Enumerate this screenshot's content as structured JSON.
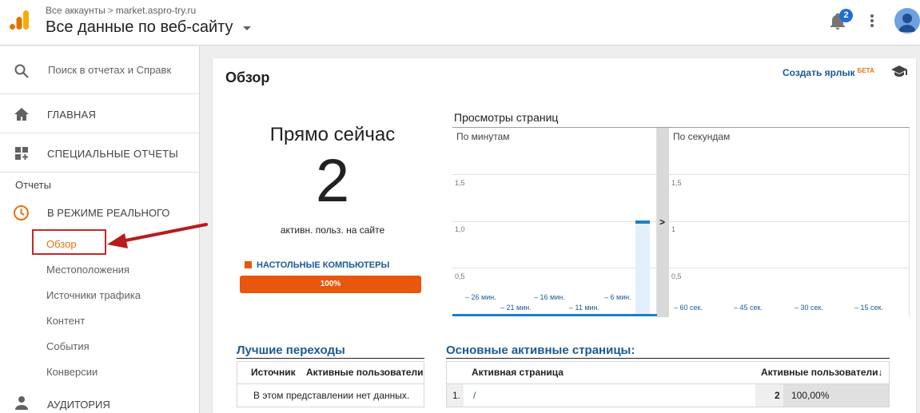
{
  "header": {
    "breadcrumb_root": "Все аккаунты",
    "breadcrumb_sep": ">",
    "breadcrumb_site": "market.aspro-try.ru",
    "view_title": "Все данные по веб-сайту",
    "notification_count": "2",
    "icons": [
      "analytics-logo-icon",
      "bell-icon",
      "more-vert-icon",
      "avatar-icon"
    ]
  },
  "sidebar": {
    "search_placeholder": "Поиск в отчетах и Справк",
    "home": "ГЛАВНАЯ",
    "custom_reports": "СПЕЦИАЛЬНЫЕ ОТЧЕТЫ",
    "section_reports": "Отчеты",
    "realtime": "В РЕЖИМЕ РЕАЛЬНОГО",
    "realtime_items": [
      "Обзор",
      "Местоположения",
      "Источники трафика",
      "Контент",
      "События",
      "Конверсии"
    ],
    "audience": "АУДИТОРИЯ",
    "accent_color": "#e8710a"
  },
  "main": {
    "title": "Обзор",
    "shortcut_label": "Создать ярлык",
    "shortcut_beta": "БЕТА",
    "right_now": {
      "title": "Прямо сейчас",
      "count": "2",
      "subtitle": "активн. польз. на сайте",
      "device_label": "НАСТОЛЬНЫЕ КОМПЬЮТЕРЫ",
      "device_percent_label": "100%",
      "device_share": 1.0,
      "device_color": "#e8570c"
    },
    "pageviews": {
      "title": "Просмотры страниц",
      "per_minute_label": "По минутам",
      "per_second_label": "По секундам",
      "minute_yticks": [
        "1,5",
        "1,0",
        "0,5"
      ],
      "second_yticks": [
        "1,5",
        "1",
        "0,5"
      ],
      "minute_xticks_top": [
        "– 26 мин.",
        "– 16 мин.",
        "– 6 мин."
      ],
      "minute_xticks_bottom": [
        "– 21 мин.",
        "– 11 мин."
      ],
      "second_xticks": [
        "– 60 сек.",
        "– 45 сек.",
        "– 30 сек.",
        "– 15 сек."
      ],
      "current_minute_value": 1.0,
      "divider_chevron": ">"
    },
    "top_referrals": {
      "title": "Лучшие переходы",
      "col_source": "Источник",
      "col_active": "Активные пользователи",
      "empty_message": "В этом представлении нет данных."
    },
    "top_pages": {
      "title": "Основные активные страницы:",
      "col_page": "Активная страница",
      "col_active": "Активные пользователи",
      "sort_arrow": "↓",
      "rows": [
        {
          "index": "1.",
          "page": "/",
          "active": "2",
          "percent": "100,00%"
        }
      ]
    }
  }
}
